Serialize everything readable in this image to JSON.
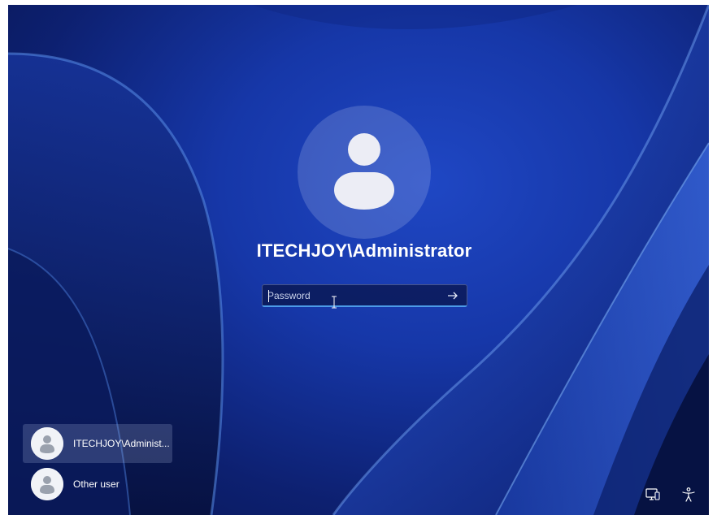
{
  "login": {
    "username": "ITECHJOY\\Administrator",
    "password_placeholder": "Password",
    "submit_icon": "arrow-right-icon"
  },
  "users": [
    {
      "name": "ITECHJOY\\Administ...",
      "selected": true,
      "icon": "user-avatar-icon"
    },
    {
      "name": "Other user",
      "selected": false,
      "icon": "user-avatar-icon"
    }
  ],
  "corner": {
    "network_icon": "network-icon",
    "accessibility_icon": "accessibility-icon"
  },
  "colors": {
    "background_primary": "#1637a8",
    "background_dark": "#081550",
    "input_accent": "#4c9be8"
  }
}
